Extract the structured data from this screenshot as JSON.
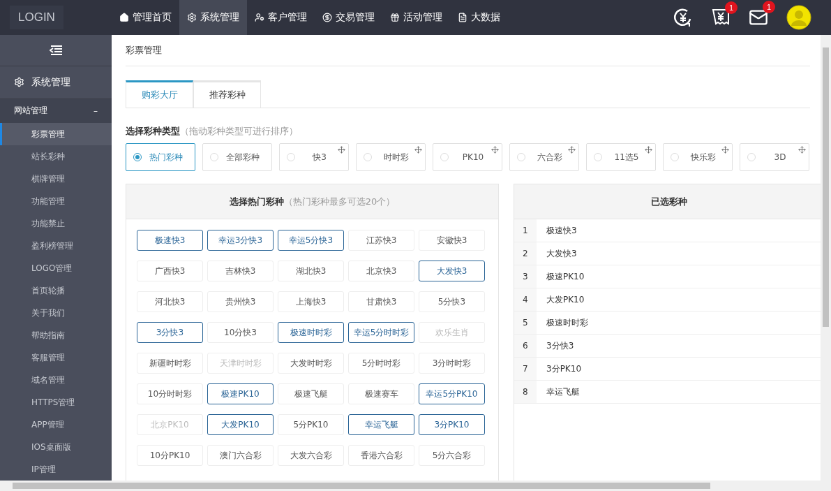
{
  "brand": "LOGIN",
  "top_nav": [
    {
      "label": "管理首页",
      "selected": false
    },
    {
      "label": "系统管理",
      "selected": true
    },
    {
      "label": "客户管理",
      "selected": false
    },
    {
      "label": "交易管理",
      "selected": false
    },
    {
      "label": "活动管理",
      "selected": false
    },
    {
      "label": "大数据",
      "selected": false
    }
  ],
  "notifications": [
    {
      "badge": "1"
    },
    {
      "badge": "1"
    }
  ],
  "sidebar": {
    "section": "系统管理",
    "group": {
      "label": "网站管理",
      "toggle": "–",
      "expanded": true
    },
    "items": [
      {
        "label": "彩票管理",
        "selected": true
      },
      {
        "label": "站长彩种",
        "selected": false
      },
      {
        "label": "棋牌管理",
        "selected": false
      },
      {
        "label": "功能管理",
        "selected": false
      },
      {
        "label": "功能禁止",
        "selected": false
      },
      {
        "label": "盈利榜管理",
        "selected": false
      },
      {
        "label": "LOGO管理",
        "selected": false
      },
      {
        "label": "首页轮播",
        "selected": false
      },
      {
        "label": "关于我们",
        "selected": false
      },
      {
        "label": "帮助指南",
        "selected": false
      },
      {
        "label": "客服管理",
        "selected": false
      },
      {
        "label": "域名管理",
        "selected": false
      },
      {
        "label": "HTTPS管理",
        "selected": false
      },
      {
        "label": "APP管理",
        "selected": false
      },
      {
        "label": "IOS桌面版",
        "selected": false
      },
      {
        "label": "IP管理",
        "selected": false
      }
    ]
  },
  "page_title": "彩票管理",
  "tabs": [
    {
      "label": "购彩大厅",
      "selected": true
    },
    {
      "label": "推荐彩种",
      "selected": false
    }
  ],
  "type_section": {
    "title": "选择彩种类型",
    "hint": "（拖动彩种类型可进行排序）"
  },
  "types": [
    {
      "label": "热门彩种",
      "selected": true,
      "draggable": false
    },
    {
      "label": "全部彩种",
      "selected": false,
      "draggable": false
    },
    {
      "label": "快3",
      "selected": false,
      "draggable": true
    },
    {
      "label": "时时彩",
      "selected": false,
      "draggable": true
    },
    {
      "label": "PK10",
      "selected": false,
      "draggable": true
    },
    {
      "label": "六合彩",
      "selected": false,
      "draggable": true
    },
    {
      "label": "11选5",
      "selected": false,
      "draggable": true
    },
    {
      "label": "快乐彩",
      "selected": false,
      "draggable": true
    },
    {
      "label": "3D",
      "selected": false,
      "draggable": true
    }
  ],
  "hot_panel": {
    "title": "选择热门彩种",
    "hint": "（热门彩种最多可选20个）",
    "items": [
      {
        "label": "极速快3",
        "selected": true,
        "disabled": false
      },
      {
        "label": "幸运3分快3",
        "selected": true,
        "disabled": false
      },
      {
        "label": "幸运5分快3",
        "selected": true,
        "disabled": false
      },
      {
        "label": "江苏快3",
        "selected": false,
        "disabled": false
      },
      {
        "label": "安徽快3",
        "selected": false,
        "disabled": false
      },
      {
        "label": "广西快3",
        "selected": false,
        "disabled": false
      },
      {
        "label": "吉林快3",
        "selected": false,
        "disabled": false
      },
      {
        "label": "湖北快3",
        "selected": false,
        "disabled": false
      },
      {
        "label": "北京快3",
        "selected": false,
        "disabled": false
      },
      {
        "label": "大发快3",
        "selected": true,
        "disabled": false
      },
      {
        "label": "河北快3",
        "selected": false,
        "disabled": false
      },
      {
        "label": "贵州快3",
        "selected": false,
        "disabled": false
      },
      {
        "label": "上海快3",
        "selected": false,
        "disabled": false
      },
      {
        "label": "甘肃快3",
        "selected": false,
        "disabled": false
      },
      {
        "label": "5分快3",
        "selected": false,
        "disabled": false
      },
      {
        "label": "3分快3",
        "selected": true,
        "disabled": false
      },
      {
        "label": "10分快3",
        "selected": false,
        "disabled": false
      },
      {
        "label": "极速时时彩",
        "selected": true,
        "disabled": false
      },
      {
        "label": "幸运5分时时彩",
        "selected": true,
        "disabled": false
      },
      {
        "label": "欢乐生肖",
        "selected": false,
        "disabled": true
      },
      {
        "label": "新疆时时彩",
        "selected": false,
        "disabled": false
      },
      {
        "label": "天津时时彩",
        "selected": false,
        "disabled": true
      },
      {
        "label": "大发时时彩",
        "selected": false,
        "disabled": false
      },
      {
        "label": "5分时时彩",
        "selected": false,
        "disabled": false
      },
      {
        "label": "3分时时彩",
        "selected": false,
        "disabled": false
      },
      {
        "label": "10分时时彩",
        "selected": false,
        "disabled": false
      },
      {
        "label": "极速PK10",
        "selected": true,
        "disabled": false
      },
      {
        "label": "极速飞艇",
        "selected": false,
        "disabled": false
      },
      {
        "label": "极速赛车",
        "selected": false,
        "disabled": false
      },
      {
        "label": "幸运5分PK10",
        "selected": true,
        "disabled": false
      },
      {
        "label": "北京PK10",
        "selected": false,
        "disabled": true
      },
      {
        "label": "大发PK10",
        "selected": true,
        "disabled": false
      },
      {
        "label": "5分PK10",
        "selected": false,
        "disabled": false
      },
      {
        "label": "幸运飞艇",
        "selected": true,
        "disabled": false
      },
      {
        "label": "3分PK10",
        "selected": true,
        "disabled": false
      },
      {
        "label": "10分PK10",
        "selected": false,
        "disabled": false
      },
      {
        "label": "澳门六合彩",
        "selected": false,
        "disabled": false
      },
      {
        "label": "大发六合彩",
        "selected": false,
        "disabled": false
      },
      {
        "label": "香港六合彩",
        "selected": false,
        "disabled": false
      },
      {
        "label": "5分六合彩",
        "selected": false,
        "disabled": false
      }
    ]
  },
  "chosen_panel": {
    "title": "已选彩种",
    "rows": [
      {
        "index": "1",
        "name": "极速快3"
      },
      {
        "index": "2",
        "name": "大发快3"
      },
      {
        "index": "3",
        "name": "极速PK10"
      },
      {
        "index": "4",
        "name": "大发PK10"
      },
      {
        "index": "5",
        "name": "极速时时彩"
      },
      {
        "index": "6",
        "name": "3分快3"
      },
      {
        "index": "7",
        "name": "3分PK10"
      },
      {
        "index": "8",
        "name": "幸运飞艇"
      }
    ]
  }
}
